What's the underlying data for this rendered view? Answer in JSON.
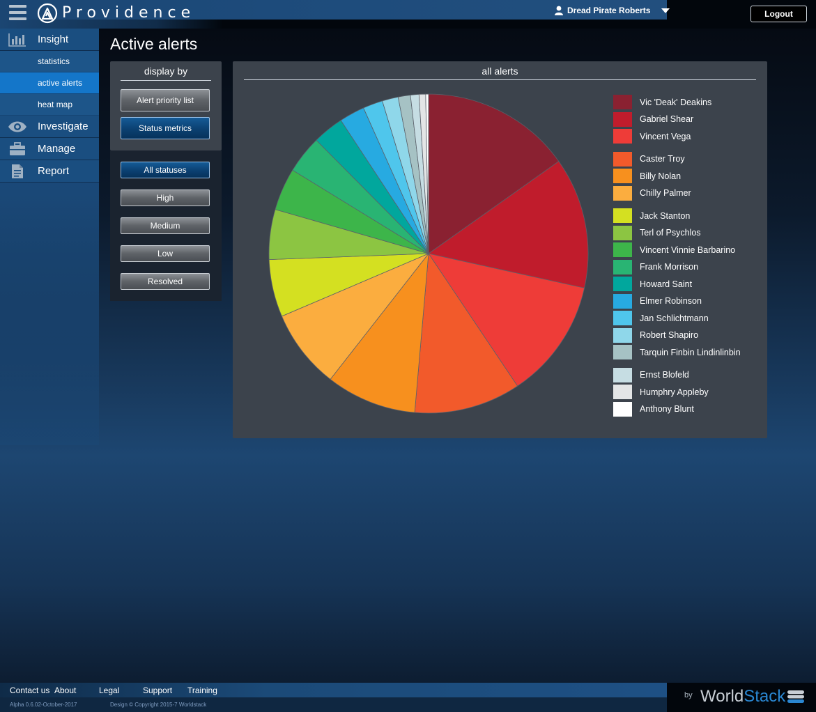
{
  "header": {
    "brand": "Providence",
    "user_name": "Dread Pirate Roberts",
    "logout_label": "Logout"
  },
  "sidebar": {
    "sections": [
      {
        "label": "Insight",
        "icon": "bar-chart-icon"
      },
      {
        "label": "Investigate",
        "icon": "eye-icon"
      },
      {
        "label": "Manage",
        "icon": "briefcase-icon"
      },
      {
        "label": "Report",
        "icon": "document-icon"
      }
    ],
    "insight_items": [
      {
        "label": "statistics",
        "active": false
      },
      {
        "label": "active alerts",
        "active": true
      },
      {
        "label": "heat map",
        "active": false
      }
    ]
  },
  "main": {
    "title": "Active alerts",
    "display_by": {
      "heading": "display by",
      "buttons": [
        {
          "label": "Alert priority list",
          "active": false
        },
        {
          "label": "Status metrics",
          "active": true
        }
      ]
    },
    "status_filters": [
      {
        "label": "All statuses",
        "active": true
      },
      {
        "label": "High",
        "active": false
      },
      {
        "label": "Medium",
        "active": false
      },
      {
        "label": "Low",
        "active": false
      },
      {
        "label": "Resolved",
        "active": false
      }
    ]
  },
  "chart_data": {
    "type": "pie",
    "title": "all alerts",
    "legend_position": "right",
    "slices": [
      {
        "name": "Vic 'Deak' Deakins",
        "value": 15.9,
        "color": "#8a2131"
      },
      {
        "name": "Gabriel Shear",
        "value": 13.9,
        "color": "#c01c2c"
      },
      {
        "name": "Vincent Vega",
        "value": 12.7,
        "color": "#ee3c38"
      },
      {
        "name": "Caster Troy",
        "value": 11.3,
        "color": "#f25a2b"
      },
      {
        "name": "Billy Nolan",
        "value": 9.6,
        "color": "#f7901e"
      },
      {
        "name": "Chilly Palmer",
        "value": 8.4,
        "color": "#fbad3f"
      },
      {
        "name": "Jack Stanton",
        "value": 6.1,
        "color": "#d4e021"
      },
      {
        "name": "Terl of Psychlos",
        "value": 5.3,
        "color": "#8cc542"
      },
      {
        "name": "Vincent Vinnie Barbarino",
        "value": 4.5,
        "color": "#3db54a"
      },
      {
        "name": "Frank Morrison",
        "value": 4.0,
        "color": "#29b473"
      },
      {
        "name": "Howard Saint",
        "value": 3.3,
        "color": "#01a79d"
      },
      {
        "name": "Elmer Robinson",
        "value": 2.7,
        "color": "#27aae1"
      },
      {
        "name": "Jan Schlichtmann",
        "value": 2.1,
        "color": "#4fc6ec"
      },
      {
        "name": "Robert Shapiro",
        "value": 1.7,
        "color": "#8fd7ea"
      },
      {
        "name": "Tarquin Finbin Lindinlinbin",
        "value": 1.3,
        "color": "#a6c2c4"
      },
      {
        "name": "Ernst Blofeld",
        "value": 0.9,
        "color": "#c6dde3"
      },
      {
        "name": "Humphry Appleby",
        "value": 0.7,
        "color": "#e3e5e6"
      },
      {
        "name": "Anthony Blunt",
        "value": 0.3,
        "color": "#ffffff"
      }
    ]
  },
  "footer": {
    "links": [
      "Contact us",
      "About",
      "Legal",
      "Support",
      "Training"
    ],
    "version": "Alpha 0.6.02-October-2017",
    "copyright": "Design © Copyright 2015-7 Worldstack",
    "by": "by",
    "logo_world": "World",
    "logo_stack": "Stack"
  }
}
